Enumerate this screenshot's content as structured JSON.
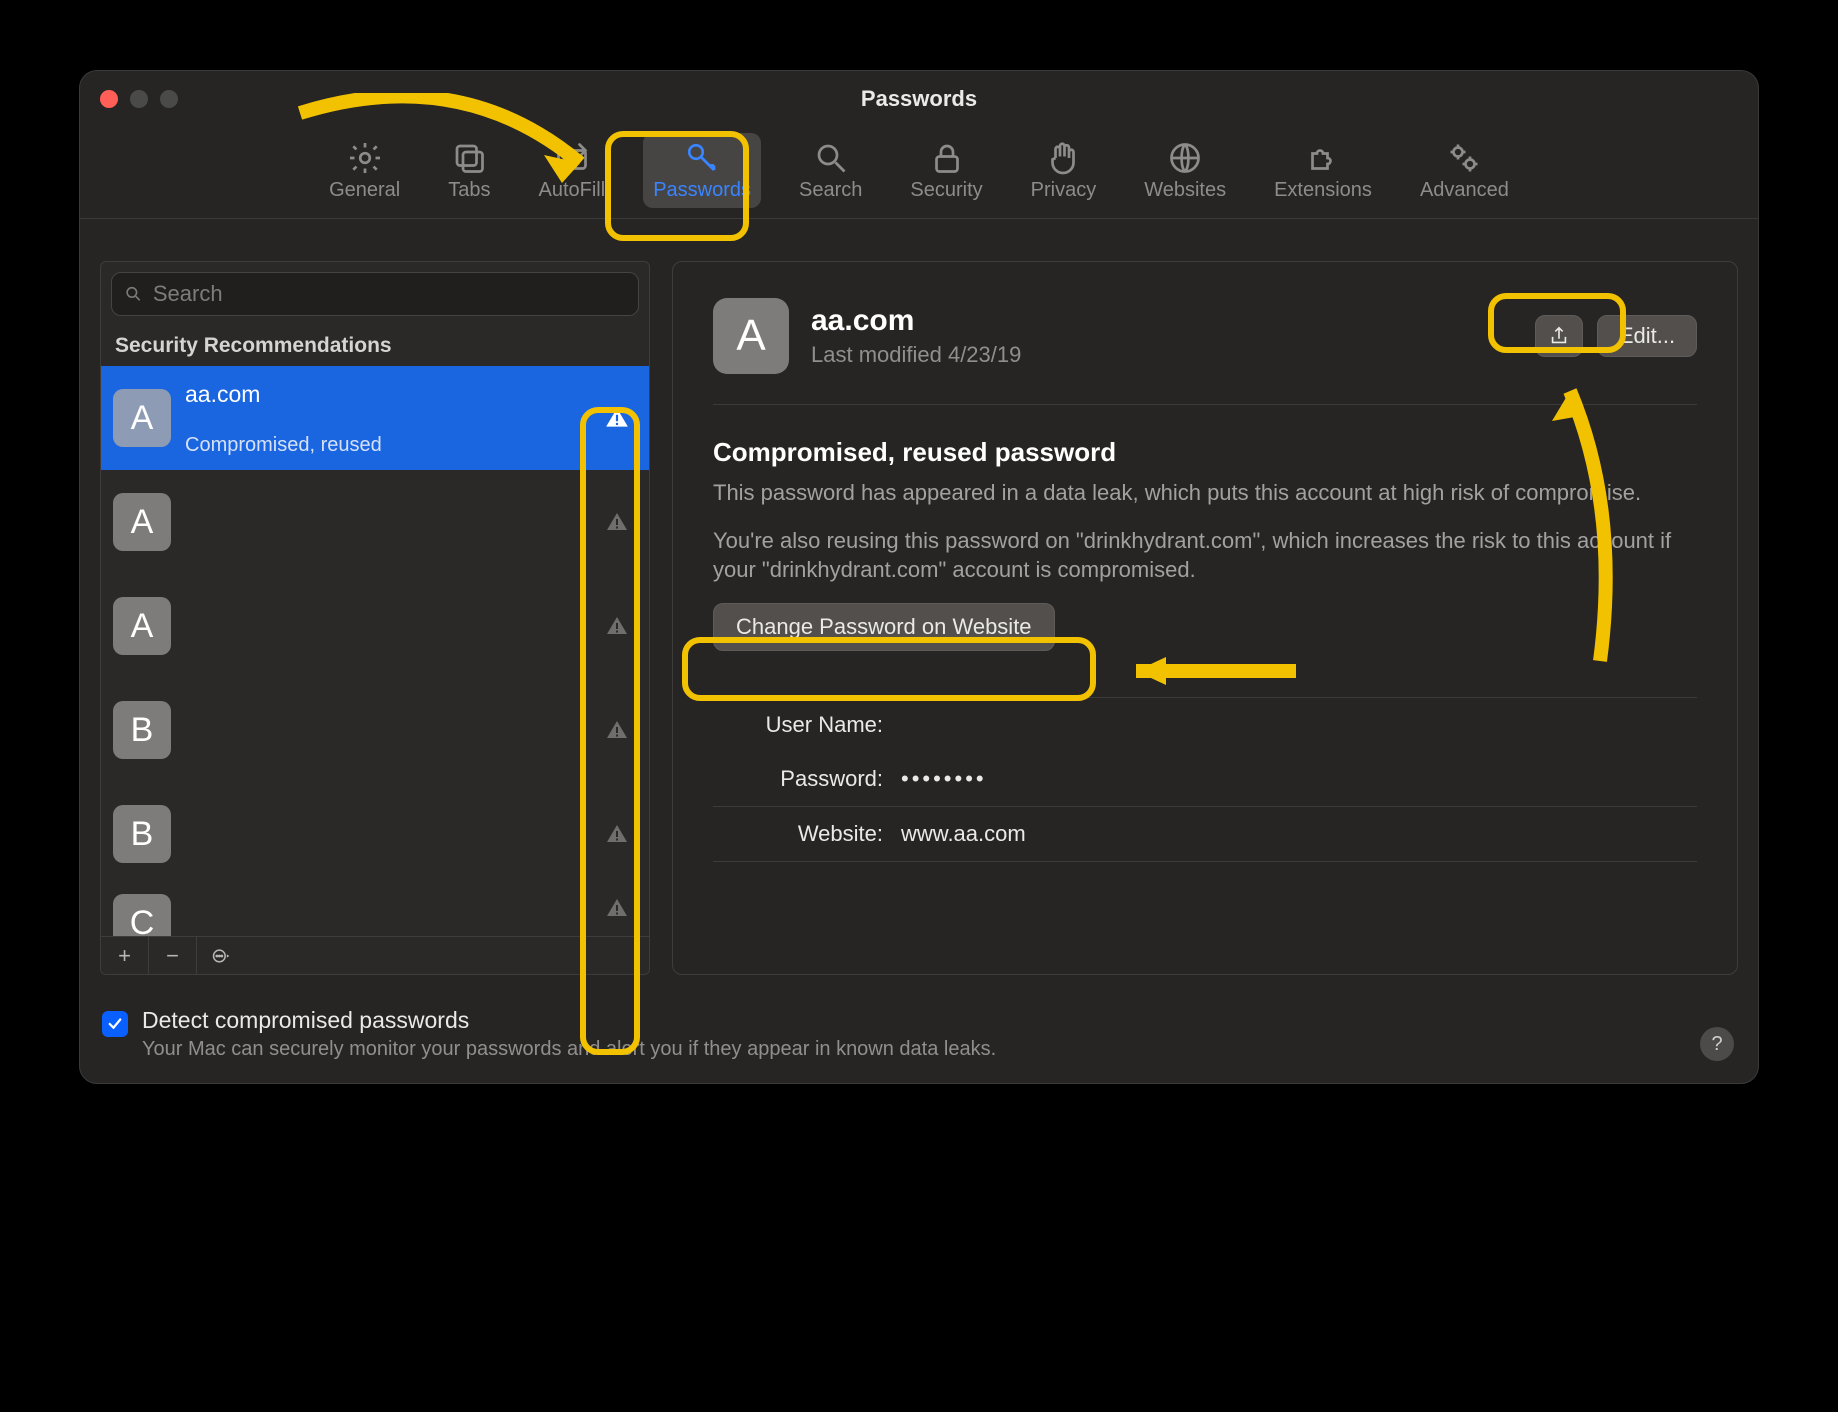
{
  "window": {
    "title": "Passwords"
  },
  "toolbar": {
    "items": [
      {
        "id": "general",
        "label": "General"
      },
      {
        "id": "tabs",
        "label": "Tabs"
      },
      {
        "id": "autofill",
        "label": "AutoFill"
      },
      {
        "id": "passwords",
        "label": "Passwords",
        "selected": true
      },
      {
        "id": "search",
        "label": "Search"
      },
      {
        "id": "security",
        "label": "Security"
      },
      {
        "id": "privacy",
        "label": "Privacy"
      },
      {
        "id": "websites",
        "label": "Websites"
      },
      {
        "id": "extensions",
        "label": "Extensions"
      },
      {
        "id": "advanced",
        "label": "Advanced"
      }
    ]
  },
  "sidebar": {
    "search_placeholder": "Search",
    "section_title": "Security Recommendations",
    "items": [
      {
        "letter": "A",
        "domain": "aa.com",
        "subtitle": "Compromised, reused",
        "warning": true,
        "selected": true
      },
      {
        "letter": "A",
        "domain": "",
        "subtitle": "",
        "warning": true
      },
      {
        "letter": "A",
        "domain": "",
        "subtitle": "",
        "warning": true
      },
      {
        "letter": "B",
        "domain": "",
        "subtitle": "",
        "warning": true
      },
      {
        "letter": "B",
        "domain": "",
        "subtitle": "",
        "warning": true
      },
      {
        "letter": "C",
        "domain": "",
        "subtitle": "",
        "warning": true
      }
    ],
    "toolbar": {
      "add": "+",
      "remove": "−",
      "more": "⊙"
    }
  },
  "detail": {
    "avatar_letter": "A",
    "domain": "aa.com",
    "modified": "Last modified 4/23/19",
    "share_label": "Share",
    "edit_label": "Edit...",
    "warning_title": "Compromised, reused password",
    "warning_body_1": "This password has appeared in a data leak, which puts this account at high risk of compromise.",
    "warning_body_2": "You're also reusing this password on \"drinkhydrant.com\", which increases the risk to this account if your \"drinkhydrant.com\" account is compromised.",
    "change_button": "Change Password on Website",
    "fields": {
      "username_label": "User Name:",
      "username_value": "",
      "password_label": "Password:",
      "password_value": "••••••••",
      "website_label": "Website:",
      "website_value": "www.aa.com"
    }
  },
  "footer": {
    "checkbox_checked": true,
    "title": "Detect compromised passwords",
    "subtitle": "Your Mac can securely monitor your passwords and alert you if they appear in known data leaks."
  }
}
